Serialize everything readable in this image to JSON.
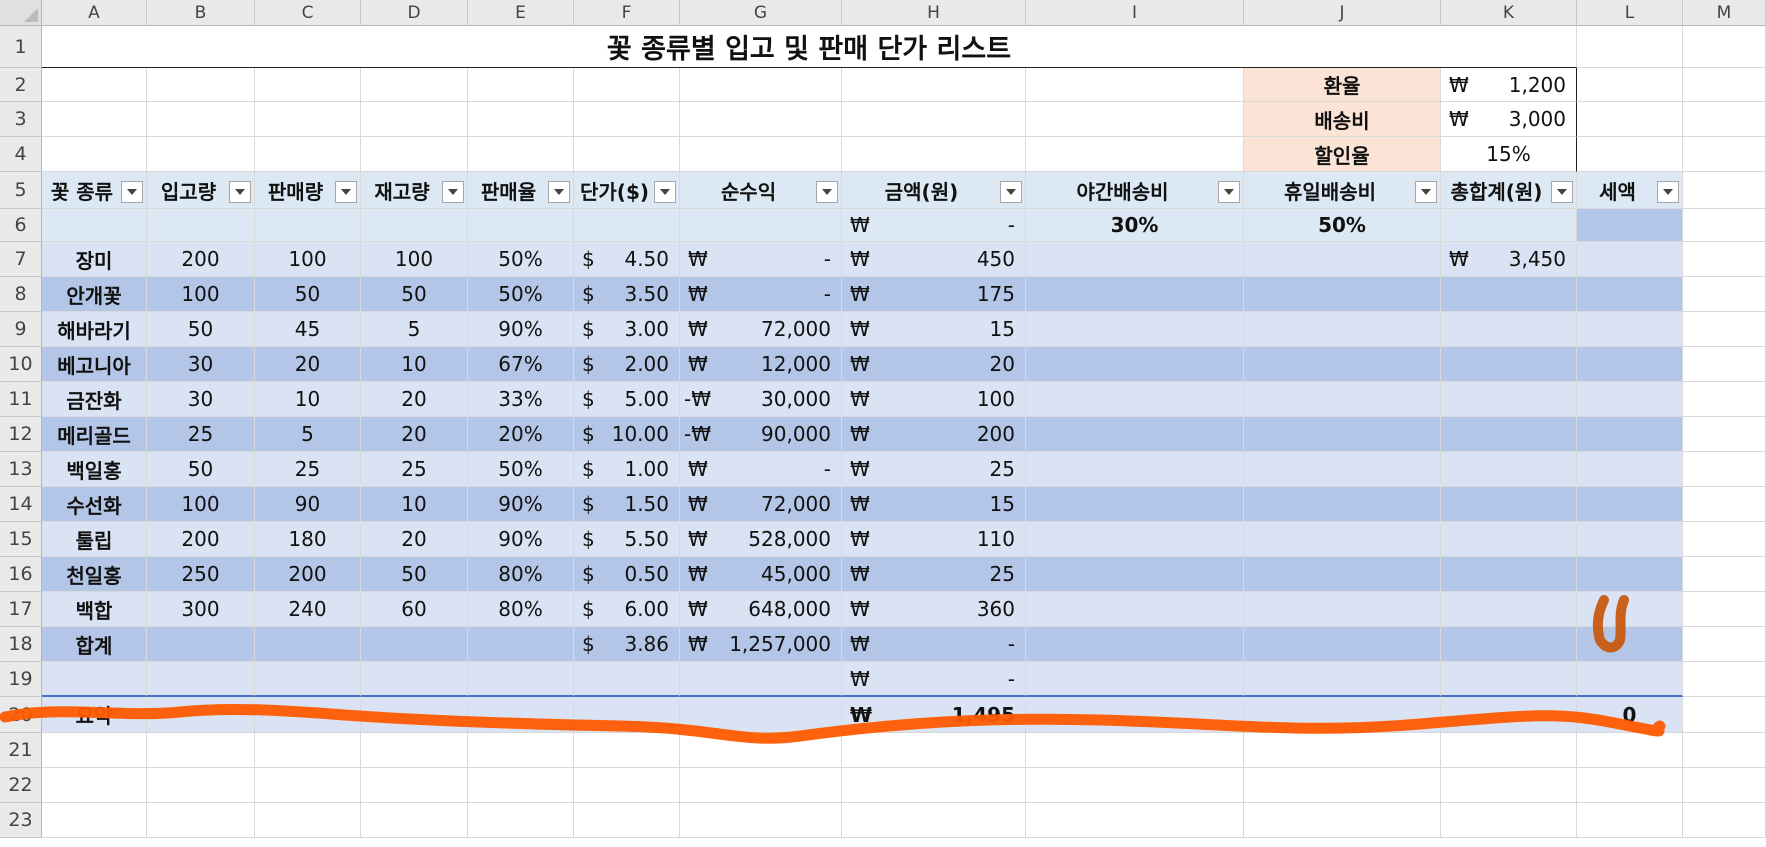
{
  "columns": [
    "A",
    "B",
    "C",
    "D",
    "E",
    "F",
    "G",
    "H",
    "I",
    "J",
    "K",
    "L",
    "M"
  ],
  "rows": [
    "1",
    "2",
    "3",
    "4",
    "5",
    "6",
    "7",
    "8",
    "9",
    "10",
    "11",
    "12",
    "13",
    "14",
    "15",
    "16",
    "17",
    "18",
    "19",
    "20",
    "21",
    "22",
    "23"
  ],
  "title": "꽃 종류별 입고 및 판매 단가 리스트",
  "params": [
    {
      "label": "환율",
      "currency": "₩",
      "value": "1,200"
    },
    {
      "label": "배송비",
      "currency": "₩",
      "value": "3,000"
    },
    {
      "label": "할인율",
      "currency": "",
      "value": "15%"
    }
  ],
  "headers": [
    "꽃 종류",
    "입고량",
    "판매량",
    "재고량",
    "판매율",
    "단가($)",
    "순수익",
    "금액(원)",
    "야간배송비",
    "휴일배송비",
    "총합계(원)",
    "세액"
  ],
  "row6": {
    "currency": "₩",
    "h": "-",
    "i": "30%",
    "j": "50%"
  },
  "data": [
    {
      "name": "장미",
      "in": "200",
      "sold": "100",
      "stock": "100",
      "rate": "50%",
      "unit": "4.50",
      "profit_sign": "",
      "profit": "-",
      "amount": "450",
      "total": "3,450"
    },
    {
      "name": "안개꽃",
      "in": "100",
      "sold": "50",
      "stock": "50",
      "rate": "50%",
      "unit": "3.50",
      "profit_sign": "",
      "profit": "-",
      "amount": "175",
      "total": ""
    },
    {
      "name": "해바라기",
      "in": "50",
      "sold": "45",
      "stock": "5",
      "rate": "90%",
      "unit": "3.00",
      "profit_sign": "",
      "profit": "72,000",
      "amount": "15",
      "total": ""
    },
    {
      "name": "베고니아",
      "in": "30",
      "sold": "20",
      "stock": "10",
      "rate": "67%",
      "unit": "2.00",
      "profit_sign": "",
      "profit": "12,000",
      "amount": "20",
      "total": ""
    },
    {
      "name": "금잔화",
      "in": "30",
      "sold": "10",
      "stock": "20",
      "rate": "33%",
      "unit": "5.00",
      "profit_sign": "-",
      "profit": "30,000",
      "amount": "100",
      "total": ""
    },
    {
      "name": "메리골드",
      "in": "25",
      "sold": "5",
      "stock": "20",
      "rate": "20%",
      "unit": "10.00",
      "profit_sign": "-",
      "profit": "90,000",
      "amount": "200",
      "total": ""
    },
    {
      "name": "백일홍",
      "in": "50",
      "sold": "25",
      "stock": "25",
      "rate": "50%",
      "unit": "1.00",
      "profit_sign": "",
      "profit": "-",
      "amount": "25",
      "total": ""
    },
    {
      "name": "수선화",
      "in": "100",
      "sold": "90",
      "stock": "10",
      "rate": "90%",
      "unit": "1.50",
      "profit_sign": "",
      "profit": "72,000",
      "amount": "15",
      "total": ""
    },
    {
      "name": "툴립",
      "in": "200",
      "sold": "180",
      "stock": "20",
      "rate": "90%",
      "unit": "5.50",
      "profit_sign": "",
      "profit": "528,000",
      "amount": "110",
      "total": ""
    },
    {
      "name": "천일홍",
      "in": "250",
      "sold": "200",
      "stock": "50",
      "rate": "80%",
      "unit": "0.50",
      "profit_sign": "",
      "profit": "45,000",
      "amount": "25",
      "total": ""
    },
    {
      "name": "백합",
      "in": "300",
      "sold": "240",
      "stock": "60",
      "rate": "80%",
      "unit": "6.00",
      "profit_sign": "",
      "profit": "648,000",
      "amount": "360",
      "total": ""
    }
  ],
  "total_row": {
    "label": "합계",
    "unit": "3.86",
    "profit": "1,257,000",
    "amount": "-"
  },
  "row19": {
    "amount": "-"
  },
  "summary": {
    "label": "요약",
    "amount": "1,495",
    "tax": "0"
  },
  "symbols": {
    "dollar": "$",
    "won": "₩"
  },
  "colors": {
    "band_light": "#dae3f3",
    "band_dark": "#b4c6e7",
    "header": "#dce9f5",
    "peach": "#fbe4d6",
    "stroke": "#ff5a00"
  }
}
